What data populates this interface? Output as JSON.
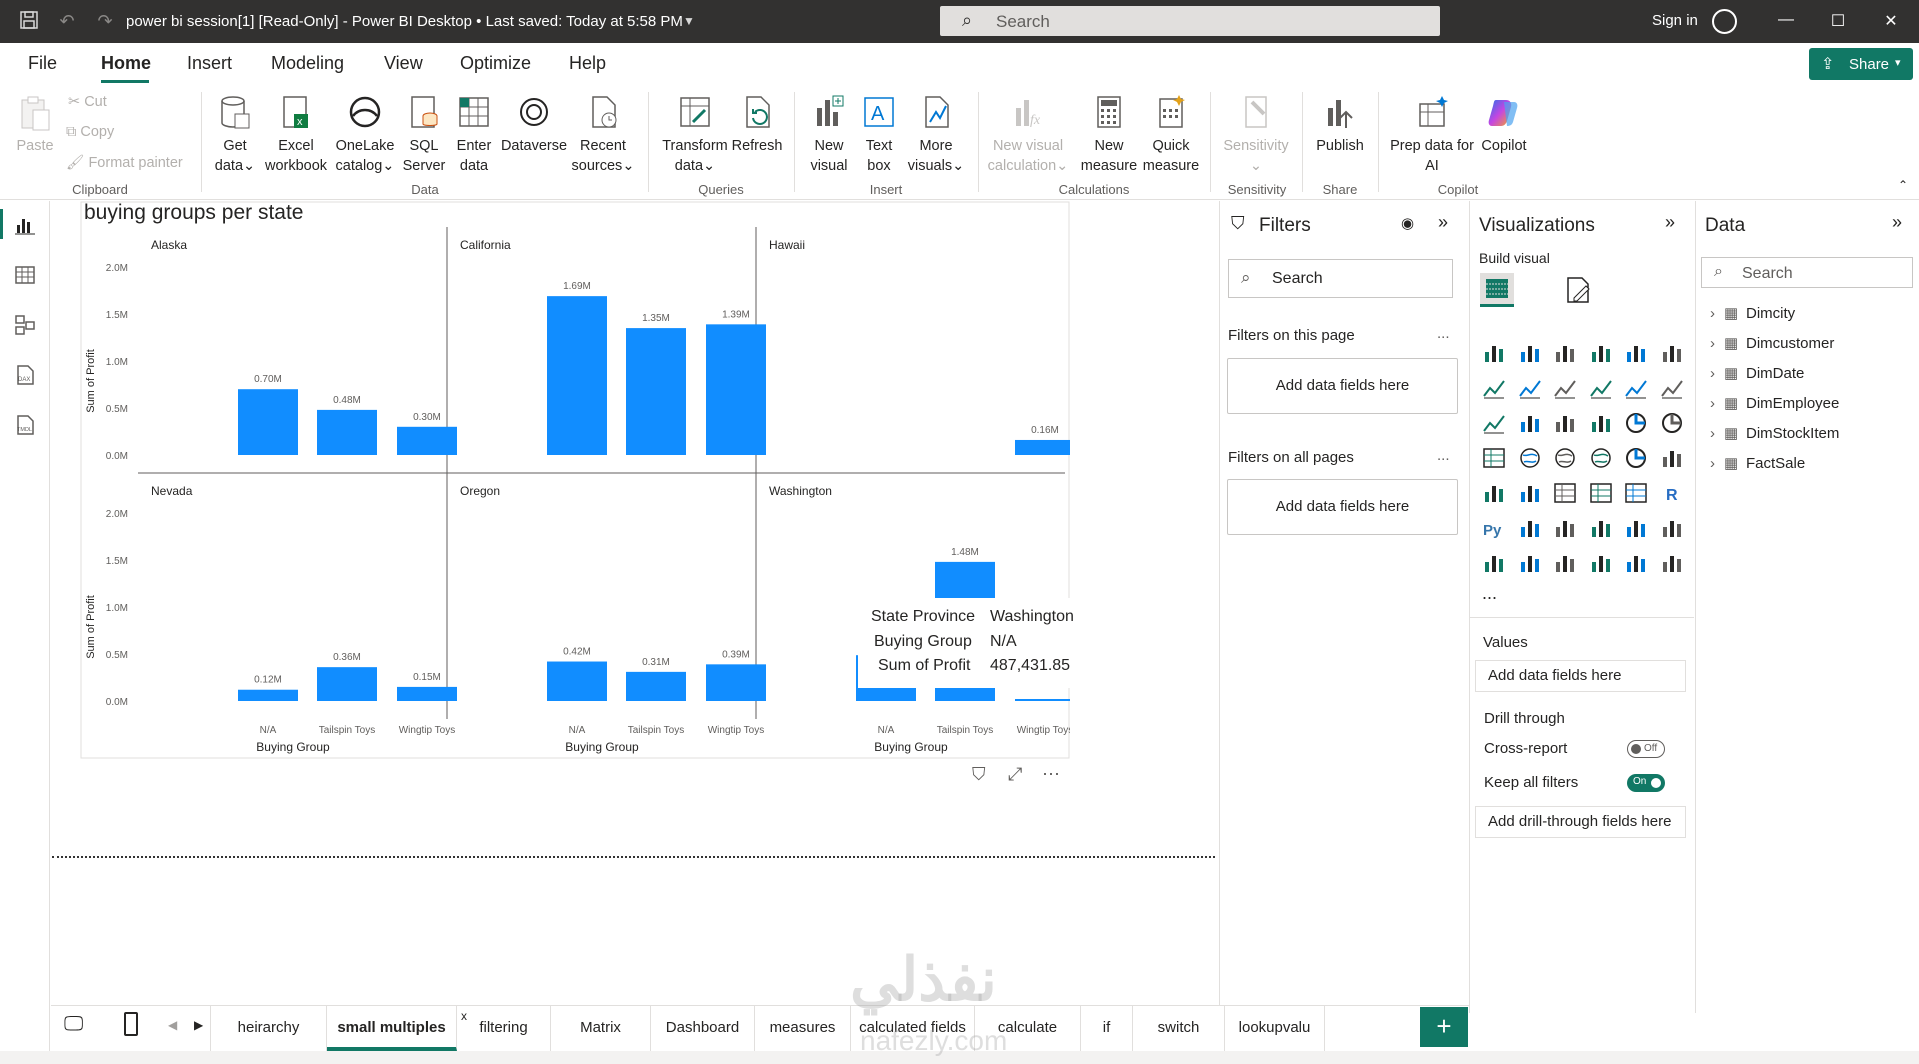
{
  "titlebar": {
    "title": "power bi session[1] [Read-Only] - Power BI Desktop  •  Last saved: Today at 5:58 PM",
    "search_placeholder": "Search",
    "sign_in": "Sign in"
  },
  "menu": {
    "tabs": [
      "File",
      "Home",
      "Insert",
      "Modeling",
      "View",
      "Optimize",
      "Help"
    ],
    "active": "Home",
    "share_label": "Share"
  },
  "ribbon": {
    "clipboard": {
      "paste": "Paste",
      "cut": "Cut",
      "copy": "Copy",
      "format_painter": "Format painter",
      "group": "Clipboard"
    },
    "data": {
      "get_data": [
        "Get",
        "data"
      ],
      "excel": [
        "Excel",
        "workbook"
      ],
      "onelake": [
        "OneLake",
        "catalog"
      ],
      "sql": [
        "SQL",
        "Server"
      ],
      "enter": [
        "Enter",
        "data"
      ],
      "dataverse": [
        "Dataverse"
      ],
      "recent": [
        "Recent",
        "sources"
      ],
      "group": "Data"
    },
    "queries": {
      "transform": [
        "Transform",
        "data"
      ],
      "refresh": [
        "Refresh"
      ],
      "group": "Queries"
    },
    "insert": {
      "new_visual": [
        "New",
        "visual"
      ],
      "text_box": [
        "Text",
        "box"
      ],
      "more_visuals": [
        "More",
        "visuals"
      ],
      "group": "Insert"
    },
    "calculations": {
      "new_visual_calc": [
        "New visual",
        "calculation"
      ],
      "new_measure": [
        "New",
        "measure"
      ],
      "quick_measure": [
        "Quick",
        "measure"
      ],
      "group": "Calculations"
    },
    "sensitivity": {
      "label": [
        "Sensitivity"
      ],
      "group": "Sensitivity"
    },
    "share": {
      "publish": [
        "Publish"
      ],
      "group": "Share"
    },
    "copilot": {
      "prep": [
        "Prep data for",
        "AI"
      ],
      "copilot": [
        "Copilot"
      ],
      "group": "Copilot"
    }
  },
  "visual": {
    "title": "buying groups per state",
    "y_axis_label": "Sum of Profit",
    "x_axis_label": "Buying Group",
    "tooltip": {
      "rows": [
        {
          "key": "State Province",
          "value": "Washington"
        },
        {
          "key": "Buying Group",
          "value": "N/A"
        },
        {
          "key": "Sum of Profit",
          "value": "487,431.85"
        }
      ]
    }
  },
  "chart_data": {
    "type": "bar",
    "title": "buying groups per state",
    "xlabel": "Buying Group",
    "ylabel": "Sum of Profit",
    "ylim": [
      0,
      2000000
    ],
    "y_ticks": [
      "0.0M",
      "0.5M",
      "1.0M",
      "1.5M",
      "2.0M"
    ],
    "categories": [
      "N/A",
      "Tailspin Toys",
      "Wingtip Toys"
    ],
    "color": "#118DFF",
    "small_multiples": [
      {
        "name": "Alaska",
        "values": [
          700000,
          480000,
          300000
        ],
        "labels": [
          "0.70M",
          "0.48M",
          "0.30M"
        ]
      },
      {
        "name": "California",
        "values": [
          1690000,
          1350000,
          1390000
        ],
        "labels": [
          "1.69M",
          "1.35M",
          "1.39M"
        ]
      },
      {
        "name": "Hawaii",
        "values": [
          null,
          null,
          160000
        ],
        "labels": [
          "",
          "",
          "0.16M"
        ]
      },
      {
        "name": "Nevada",
        "values": [
          120000,
          360000,
          150000
        ],
        "labels": [
          "0.12M",
          "0.36M",
          "0.15M"
        ]
      },
      {
        "name": "Oregon",
        "values": [
          420000,
          310000,
          390000
        ],
        "labels": [
          "0.42M",
          "0.31M",
          "0.39M"
        ]
      },
      {
        "name": "Washington",
        "values": [
          487431.85,
          1480000,
          10000
        ],
        "labels": [
          "0.49M",
          "1.48M",
          ""
        ]
      }
    ]
  },
  "filters": {
    "title": "Filters",
    "search": "Search",
    "this_page": "Filters on this page",
    "all_pages": "Filters on all pages",
    "add_fields": "Add data fields here",
    "dots": "..."
  },
  "visualizations": {
    "title": "Visualizations",
    "build_visual": "Build visual",
    "more": "...",
    "values_label": "Values",
    "values_well": "Add data fields here",
    "drill_through": "Drill through",
    "cross_report": "Cross-report",
    "cross_report_state": "Off",
    "keep_all_filters": "Keep all filters",
    "keep_all_state": "On",
    "drill_well": "Add drill-through fields here"
  },
  "data_pane": {
    "title": "Data",
    "search": "Search",
    "tables": [
      "Dimcity",
      "Dimcustomer",
      "DimDate",
      "DimEmployee",
      "DimStockItem",
      "FactSale"
    ]
  },
  "pages": {
    "tabs": [
      "heirarchy",
      "small multiples",
      "filtering",
      "Matrix",
      "Dashboard",
      "measures",
      "calculated fields",
      "calculate",
      "if",
      "switch",
      "lookupvalu"
    ],
    "active": "small multiples",
    "close": "x",
    "add": "+"
  },
  "watermark": {
    "text": "نفذلي",
    "sub": "nafezly.com"
  },
  "colors": {
    "accent": "#117865",
    "bar": "#118DFF",
    "titlebar": "#323130"
  }
}
